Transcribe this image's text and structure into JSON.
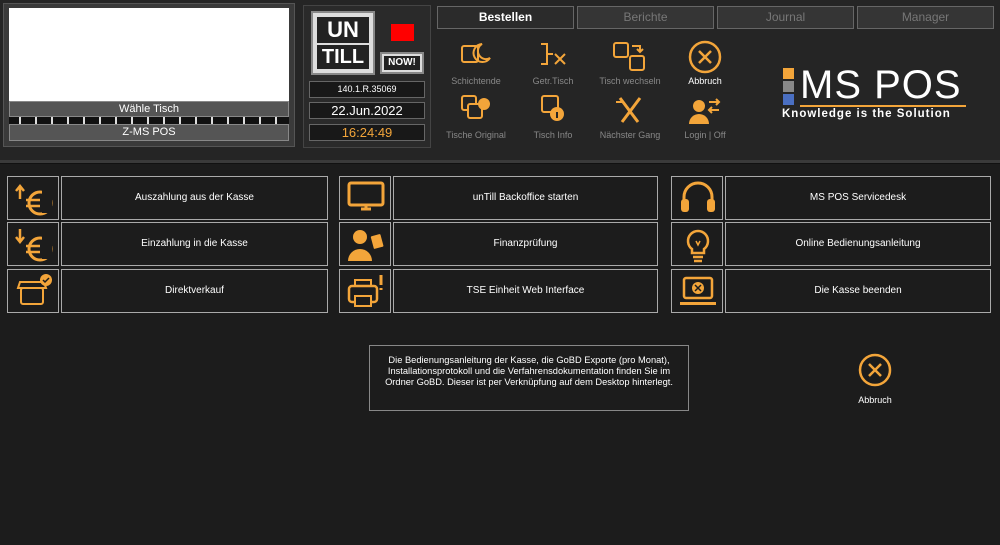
{
  "table_panel": {
    "choose_table": "Wähle Tisch",
    "register": "Z-MS POS"
  },
  "logo_panel": {
    "untill_top": "UN",
    "untill_bottom": "TILL",
    "now": "NOW!",
    "version": "140.1.R.35069",
    "date": "22.Jun.2022",
    "time": "16:24:49"
  },
  "tabs": [
    {
      "label": "Bestellen",
      "active": true
    },
    {
      "label": "Berichte",
      "active": false
    },
    {
      "label": "Journal",
      "active": false
    },
    {
      "label": "Manager",
      "active": false
    }
  ],
  "toolbar": [
    {
      "label": "Schichtende",
      "icon": "shift-end-icon"
    },
    {
      "label": "Getr.Tisch",
      "icon": "split-table-icon"
    },
    {
      "label": "Tisch wechseln",
      "icon": "switch-table-icon"
    },
    {
      "label": "Abbruch",
      "icon": "cancel-icon"
    },
    {
      "label": "Tische Original",
      "icon": "tables-original-icon"
    },
    {
      "label": "Tisch Info",
      "icon": "table-info-icon"
    },
    {
      "label": "Nächster Gang",
      "icon": "next-course-icon"
    },
    {
      "label": "Login | Off",
      "icon": "login-icon"
    }
  ],
  "brand": {
    "name": "MS POS",
    "tagline": "Knowledge is the Solution",
    "colors": {
      "orange": "#f3a53a",
      "blue": "#4a6fc2",
      "gray": "#888888"
    }
  },
  "menu": {
    "col1": [
      {
        "label": "Auszahlung aus der Kasse",
        "icon": "euro-payout-icon"
      },
      {
        "label": "Einzahlung in die Kasse",
        "icon": "euro-deposit-icon"
      },
      {
        "label": "Direktverkauf",
        "icon": "shop-icon"
      }
    ],
    "col2": [
      {
        "label": "unTill Backoffice starten",
        "icon": "monitor-icon"
      },
      {
        "label": "Finanzprüfung",
        "icon": "auditor-icon"
      },
      {
        "label": "TSE Einheit Web Interface",
        "icon": "printer-alert-icon"
      }
    ],
    "col3": [
      {
        "label": "MS POS Servicedesk",
        "icon": "headset-icon"
      },
      {
        "label": "Online Bedienungsanleitung",
        "icon": "lightbulb-icon"
      },
      {
        "label": "Die Kasse beenden",
        "icon": "laptop-close-icon"
      }
    ]
  },
  "info_text": "Die Bedienungsanleitung der Kasse, die GoBD Exporte (pro Monat), Installationsprotokoll und die Verfahrensdokumentation finden Sie im Ordner GoBD. Dieser ist per Verknüpfung auf dem Desktop hinterlegt.",
  "cancel_label": "Abbruch",
  "accent_color": "#f3a53a"
}
